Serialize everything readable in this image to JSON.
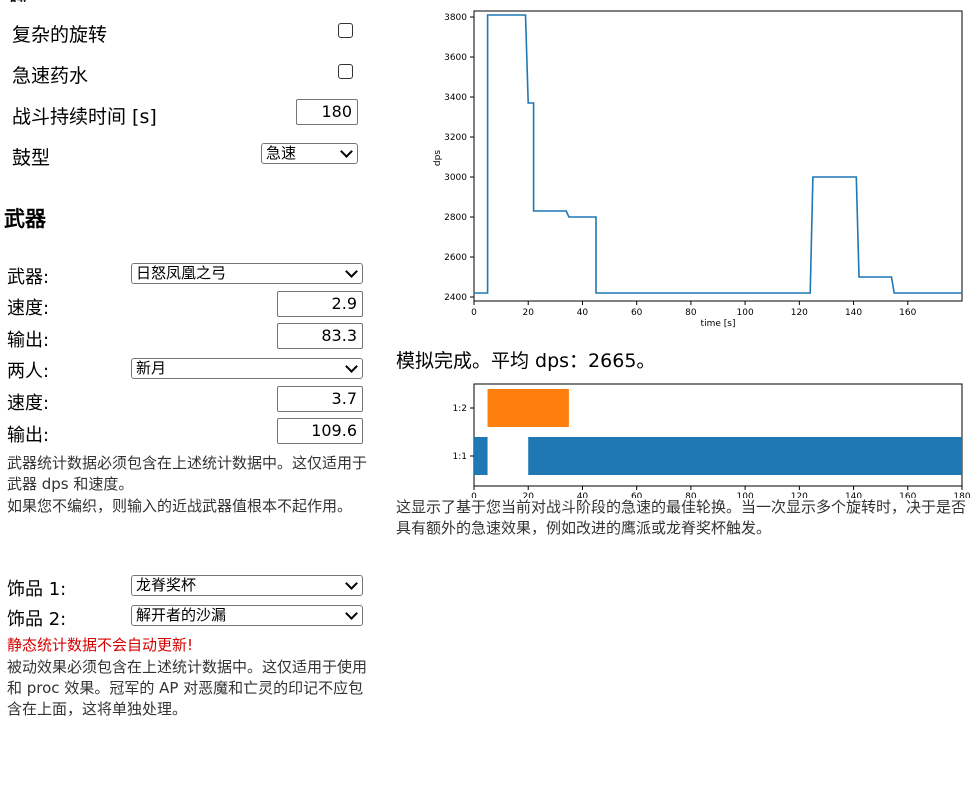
{
  "settings": {
    "complex_rotation_label": "复杂的旋转",
    "haste_potion_label": "急速药水",
    "duration_label": "战斗持续时间 [s]",
    "duration_value": "180",
    "drum_label": "鼓型",
    "drum_value": "急速"
  },
  "weapons": {
    "heading": "武器",
    "weapon_label": "武器:",
    "weapon_value": "日怒凤凰之弓",
    "speed1_label": "速度:",
    "speed1_value": "2.9",
    "dps1_label": "输出:",
    "dps1_value": "83.3",
    "twohand_label": "两人:",
    "twohand_value": "新月",
    "speed2_label": "速度:",
    "speed2_value": "3.7",
    "dps2_label": "输出:",
    "dps2_value": "109.6",
    "note1": "武器统计数据必须包含在上述统计数据中。这仅适用于武器 dps 和速度。",
    "note2": "如果您不编织，则输入的近战武器值根本不起作用。"
  },
  "trinkets": {
    "trinket1_label": "饰品 1:",
    "trinket1_value": "龙脊奖杯",
    "trinket2_label": "饰品 2:",
    "trinket2_value": "解开者的沙漏",
    "warning": "静态统计数据不会自动更新!",
    "note": "被动效果必须包含在上述统计数据中。这仅适用于使用和 proc 效果。冠军的 AP 对恶魔和亡灵的印记不应包含在上面，这将单独处理。"
  },
  "results": {
    "summary": "模拟完成。平均 dps：2665。",
    "explanation": "这显示了基于您当前对战斗阶段的急速的最佳轮换。当一次显示多个旋转时，决于是否具有额外的急速效果，例如改进的鹰派或龙脊奖杯触发。"
  },
  "chart_data": [
    {
      "type": "line",
      "xlabel": "time [s]",
      "ylabel": "dps",
      "xlim": [
        0,
        180
      ],
      "ylim": [
        2380,
        3830
      ],
      "xticks": [
        0,
        20,
        40,
        60,
        80,
        100,
        120,
        140,
        160
      ],
      "yticks": [
        2400,
        2600,
        2800,
        3000,
        3200,
        3400,
        3600,
        3800
      ],
      "color": "#1f77b4",
      "x": [
        0,
        5,
        5,
        19,
        20,
        22,
        22,
        34,
        35,
        45,
        45,
        124,
        125,
        141,
        142,
        154,
        155,
        180
      ],
      "y": [
        2420,
        2420,
        3810,
        3810,
        3370,
        3370,
        2830,
        2830,
        2800,
        2800,
        2420,
        2420,
        3000,
        3000,
        2500,
        2500,
        2420,
        2420
      ]
    },
    {
      "type": "bar",
      "orientation": "horizontal-broken",
      "categories": [
        "1:1",
        "1:2"
      ],
      "xlim": [
        0,
        180
      ],
      "xticks": [
        0,
        20,
        40,
        60,
        80,
        100,
        120,
        140,
        160,
        180
      ],
      "bars": [
        {
          "row": "1:2",
          "start": 5,
          "end": 35,
          "color": "#ff7f0e"
        },
        {
          "row": "1:1",
          "start": 0,
          "end": 5,
          "color": "#1f77b4"
        },
        {
          "row": "1:1",
          "start": 20,
          "end": 180,
          "color": "#1f77b4"
        }
      ]
    }
  ]
}
